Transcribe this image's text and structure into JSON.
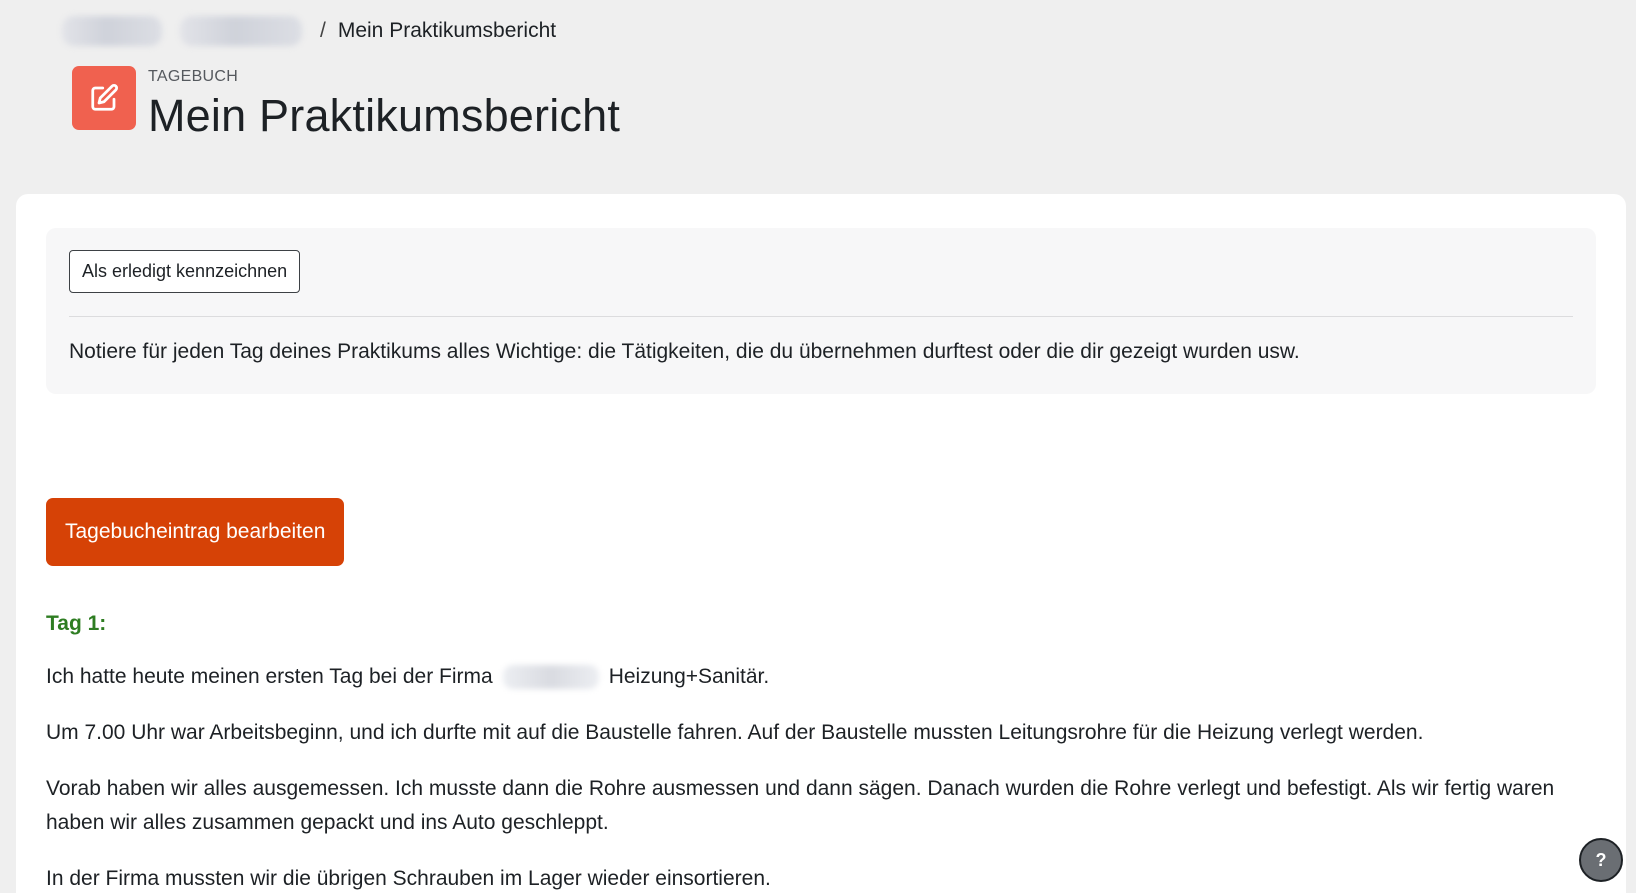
{
  "breadcrumb": {
    "separator": "/",
    "current": "Mein Praktikumsbericht"
  },
  "header": {
    "icon": "edit-icon",
    "subtitle": "TAGEBUCH",
    "title": "Mein Praktikumsbericht"
  },
  "info": {
    "done_button": "Als erledigt kennzeichnen",
    "description": "Notiere für jeden Tag deines Praktikums alles Wichtige: die Tätigkeiten, die du übernehmen durftest oder die dir gezeigt wurden usw."
  },
  "edit_button": "Tagebucheintrag bearbeiten",
  "entry": {
    "day": "Tag 1:",
    "p1_before": "Ich hatte heute meinen ersten Tag bei der Firma",
    "p1_after": "Heizung+Sanitär.",
    "p2": "Um 7.00 Uhr war Arbeitsbeginn, und ich durfte mit auf die Baustelle fahren. Auf der Baustelle mussten Leitungsrohre für die Heizung verlegt werden.",
    "p3": "Vorab haben wir alles ausgemessen. Ich musste dann die Rohre ausmessen und dann sägen. Danach wurden die Rohre verlegt und befestigt. Als wir fertig waren haben wir alles zusammen gepackt und ins Auto geschleppt.",
    "p4": "In der Firma mussten wir die übrigen Schrauben im Lager wieder einsortieren."
  },
  "help_button": "?",
  "colors": {
    "accent_button": "#d64206",
    "icon_bg": "#f0614f",
    "day_heading": "#2e7d22",
    "page_bg": "#efefef"
  }
}
